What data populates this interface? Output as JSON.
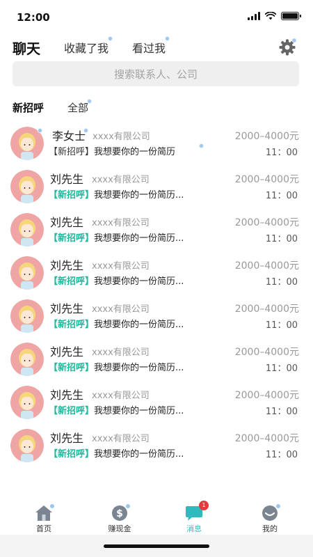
{
  "status": {
    "time": "12:00"
  },
  "top_tabs": [
    {
      "label": "聊天",
      "active": true
    },
    {
      "label": "收藏了我",
      "active": false
    },
    {
      "label": "看过我",
      "active": false
    }
  ],
  "search": {
    "placeholder": "搜索联系人、公司"
  },
  "sub_tabs": [
    {
      "label": "新招呼",
      "active": true
    },
    {
      "label": "全部",
      "active": false
    }
  ],
  "chats": [
    {
      "name": "李女士",
      "company": "xxxx有限公司",
      "salary": "2000–4000元",
      "tag": "【新招呼】",
      "message": "我想要你的一份简历",
      "time": "11：00"
    },
    {
      "name": "刘先生",
      "company": "xxxx有限公司",
      "salary": "2000–4000元",
      "tag": "【新招呼】",
      "message": "我想要你的一份简历...",
      "time": "11：00"
    },
    {
      "name": "刘先生",
      "company": "xxxx有限公司",
      "salary": "2000–4000元",
      "tag": "【新招呼】",
      "message": "我想要你的一份简历...",
      "time": "11：00"
    },
    {
      "name": "刘先生",
      "company": "xxxx有限公司",
      "salary": "2000–4000元",
      "tag": "【新招呼】",
      "message": "我想要你的一份简历...",
      "time": "11：00"
    },
    {
      "name": "刘先生",
      "company": "xxxx有限公司",
      "salary": "2000–4000元",
      "tag": "【新招呼】",
      "message": "我想要你的一份简历...",
      "time": "11：00"
    },
    {
      "name": "刘先生",
      "company": "xxxx有限公司",
      "salary": "2000–4000元",
      "tag": "【新招呼】",
      "message": "我想要你的一份简历...",
      "time": "11：00"
    },
    {
      "name": "刘先生",
      "company": "xxxx有限公司",
      "salary": "2000–4000元",
      "tag": "【新招呼】",
      "message": "我想要你的一份简历...",
      "time": "11：00"
    },
    {
      "name": "刘先生",
      "company": "xxxx有限公司",
      "salary": "2000–4000元",
      "tag": "【新招呼】",
      "message": "我想要你的一份简历...",
      "time": "11：00"
    }
  ],
  "tabbar": [
    {
      "label": "首页",
      "icon": "home-icon",
      "active": false
    },
    {
      "label": "赚现金",
      "icon": "dollar-coin-icon",
      "active": false
    },
    {
      "label": "消息",
      "icon": "chat-bubble-icon",
      "active": true,
      "badge": "1"
    },
    {
      "label": "我的",
      "icon": "smiley-face-icon",
      "active": false
    }
  ],
  "colors": {
    "accent": "#2fbbbe",
    "tag_green": "#1fb89c",
    "badge_red": "#e23b3b",
    "avatar_bg": "#f0a5a5"
  }
}
